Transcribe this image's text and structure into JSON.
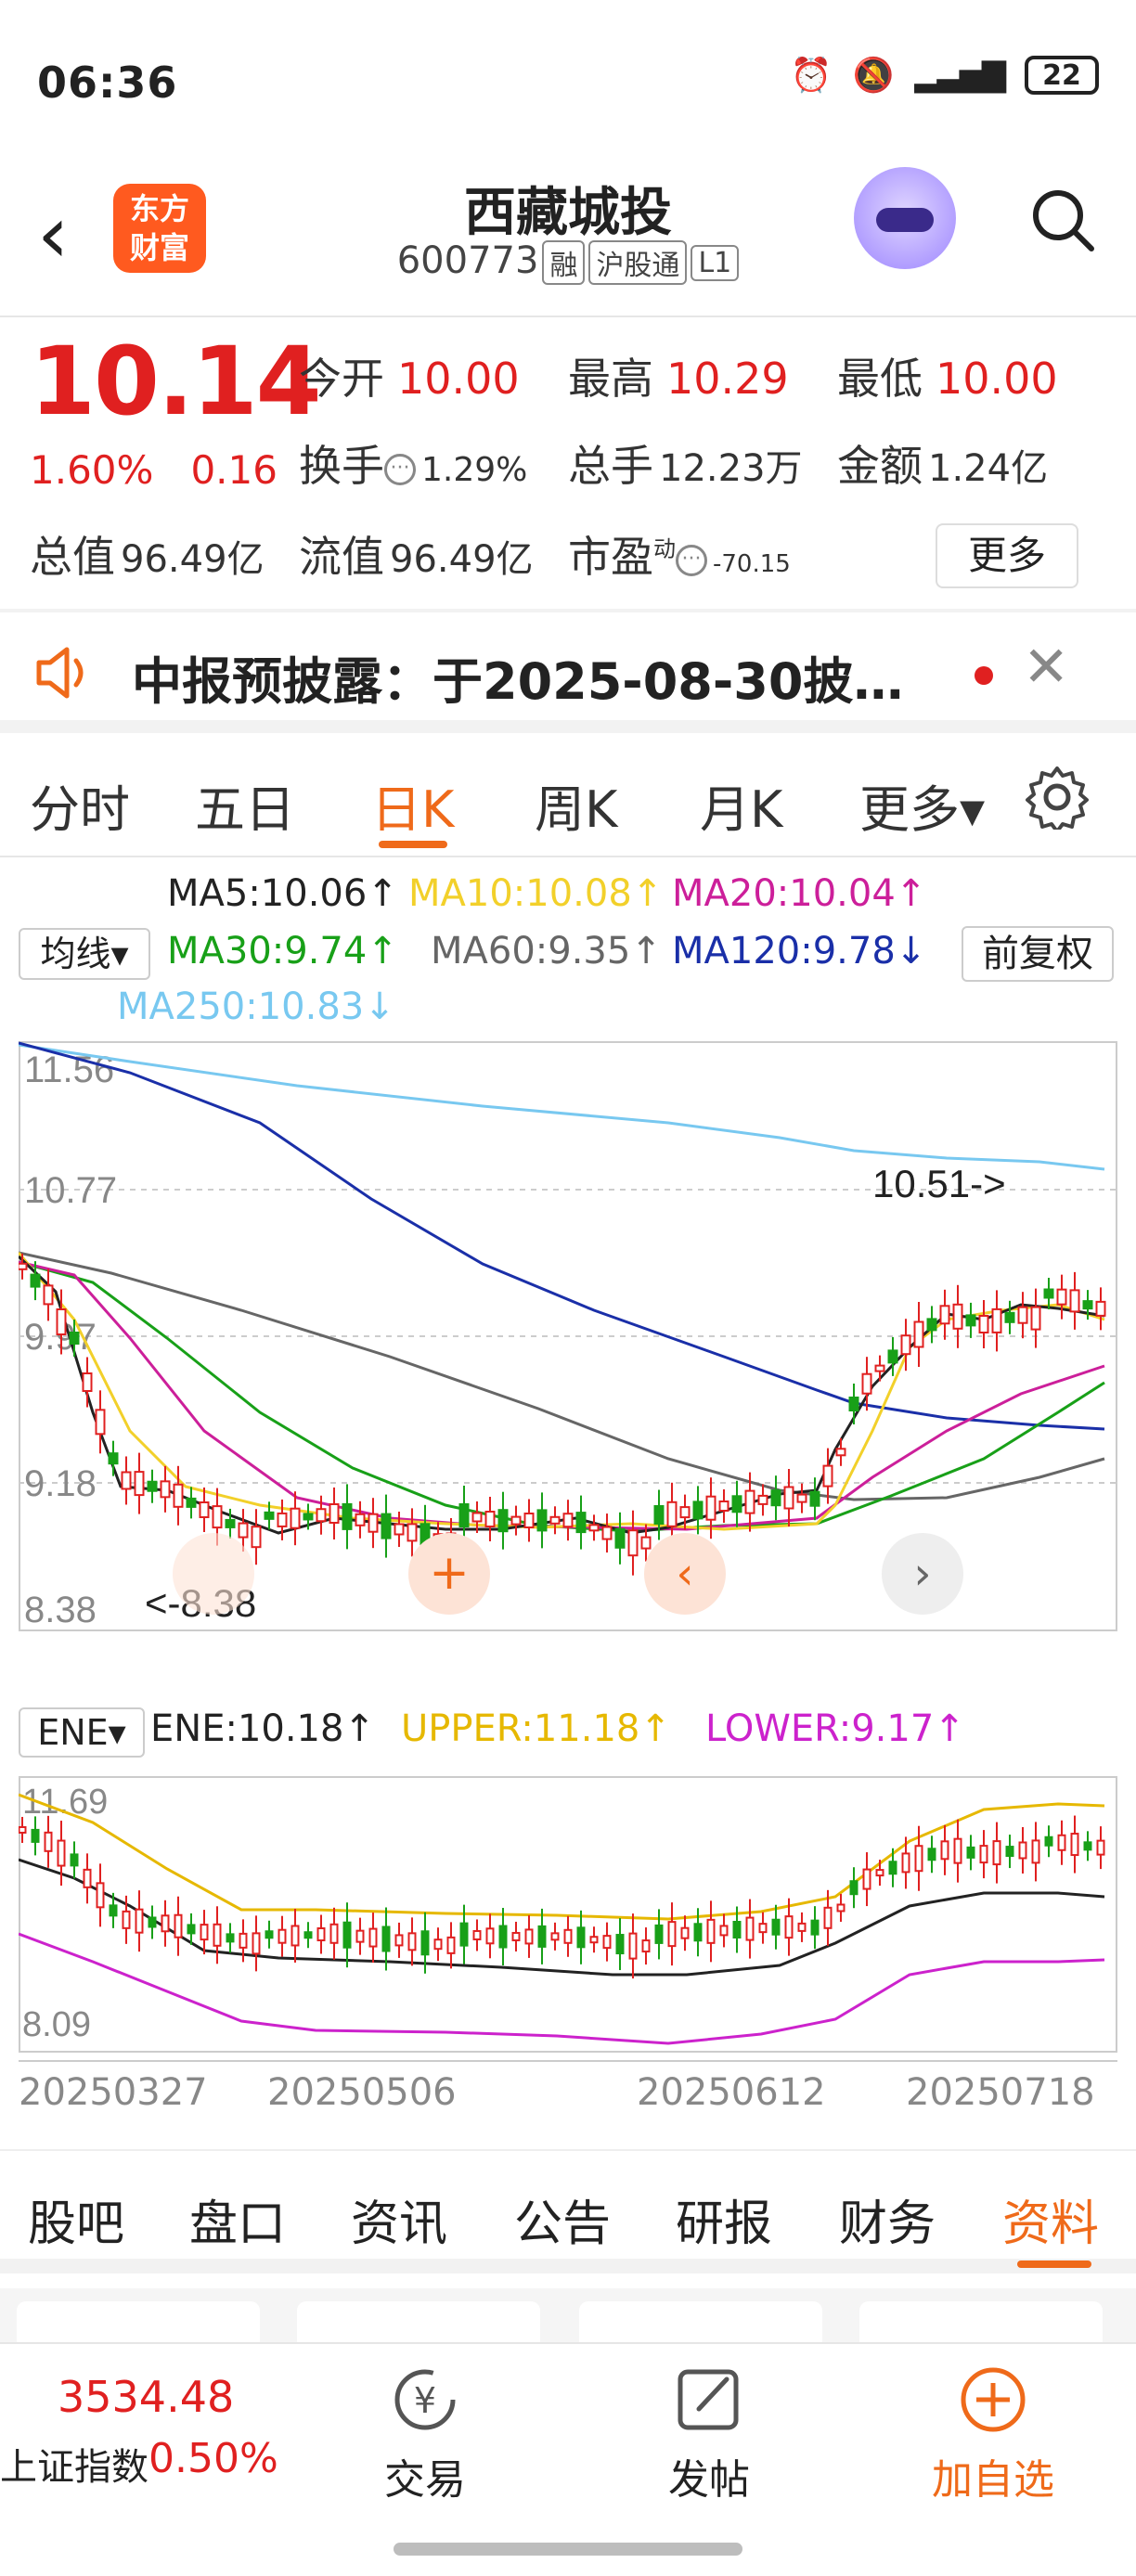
{
  "status": {
    "time": "06:36",
    "battery": "22"
  },
  "header": {
    "logo_line1": "东方",
    "logo_line2": "财富",
    "title": "西藏城投",
    "code": "600773",
    "tags": [
      "融",
      "沪股通",
      "L1"
    ]
  },
  "quote": {
    "price": "10.14",
    "change_pct": "1.60%",
    "change_amt": "0.16",
    "open_label": "今开",
    "open": "10.00",
    "high_label": "最高",
    "high": "10.29",
    "low_label": "最低",
    "low": "10.00",
    "turnover_label": "换手",
    "turnover": "1.29%",
    "volume_label": "总手",
    "volume": "12.23万",
    "amount_label": "金额",
    "amount": "1.24亿",
    "mktcap_label": "总值",
    "mktcap": "96.49亿",
    "float_label": "流值",
    "float_cap": "96.49亿",
    "pe_label": "市盈",
    "pe_sup": "动",
    "pe": "-70.15",
    "more": "更多"
  },
  "notice": {
    "text": "中报预披露：于2025-08-30披…"
  },
  "ktabs": [
    {
      "label": "分时"
    },
    {
      "label": "五日"
    },
    {
      "label": "日K"
    },
    {
      "label": "周K"
    },
    {
      "label": "月K"
    },
    {
      "label": "更多▾"
    }
  ],
  "ma": {
    "selector": "均线▾",
    "fq": "前复权",
    "ma5": "MA5:10.06↑",
    "ma10": "MA10:10.08↑",
    "ma20": "MA20:10.04↑",
    "ma30": "MA30:9.74↑",
    "ma60": "MA60:9.35↑",
    "ma120": "MA120:9.78↓",
    "ma250": "MA250:10.83↓",
    "colors": {
      "ma5": "#222222",
      "ma10": "#f2d02a",
      "ma20": "#cc1f9a",
      "ma30": "#18a018",
      "ma60": "#666666",
      "ma120": "#1a2fa8",
      "ma250": "#78c8f0"
    }
  },
  "kchart": {
    "y_top": "11.56",
    "y_2": "10.77",
    "y_3": "9.97",
    "y_4": "9.18",
    "y_bottom": "8.38",
    "high_label": "10.51->",
    "low_label": "<-8.38"
  },
  "ene": {
    "selector": "ENE▾",
    "ene": "ENE:10.18↑",
    "upper": "UPPER:11.18↑",
    "lower": "LOWER:9.17↑",
    "y_top": "11.69",
    "y_bottom": "8.09"
  },
  "xaxis": [
    "20250327",
    "20250506",
    "20250612",
    "20250718"
  ],
  "chart_data": {
    "type": "candlestick",
    "ylim": [
      8.38,
      11.56
    ],
    "x_range": [
      "20250327",
      "20250718"
    ],
    "extremes": {
      "high": 10.51,
      "low": 8.38
    },
    "latest": {
      "MA5": 10.06,
      "MA10": 10.08,
      "MA20": 10.04,
      "MA30": 9.74,
      "MA60": 9.35,
      "MA120": 9.78,
      "MA250": 10.83,
      "ENE": 10.18,
      "UPPER": 11.18,
      "LOWER": 9.17
    }
  },
  "bottom_tabs": [
    {
      "label": "股吧"
    },
    {
      "label": "盘口"
    },
    {
      "label": "资讯"
    },
    {
      "label": "公告"
    },
    {
      "label": "研报"
    },
    {
      "label": "财务"
    },
    {
      "label": "资料"
    }
  ],
  "nav": {
    "index_value": "3534.48",
    "index_name": "上证指数",
    "index_pct": "0.50%",
    "trade": "交易",
    "post": "发帖",
    "add": "加自选"
  }
}
